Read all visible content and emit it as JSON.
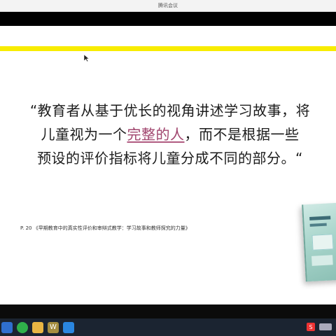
{
  "window": {
    "title": "腾讯会议"
  },
  "slide": {
    "quote_lines": [
      "“教育者从基于优长的视角讲述学习故事，将",
      "儿童视为一个",
      "完整的人",
      "，而不是根据一些",
      "预设的评价指标将儿童分成不同的部分。“"
    ],
    "citation": "P. 20 《早期教育中的真实性评价和审辩式教学：学习故事和教师探究的力量》",
    "accent_color": "#f8ec00",
    "highlight_color": "#a0446d"
  },
  "taskbar": {
    "icons": [
      "search-icon",
      "wechat-icon",
      "folder-icon",
      "word-icon",
      "tencent-meeting-icon"
    ],
    "word_glyph": "W",
    "tray_glyph": "S"
  }
}
